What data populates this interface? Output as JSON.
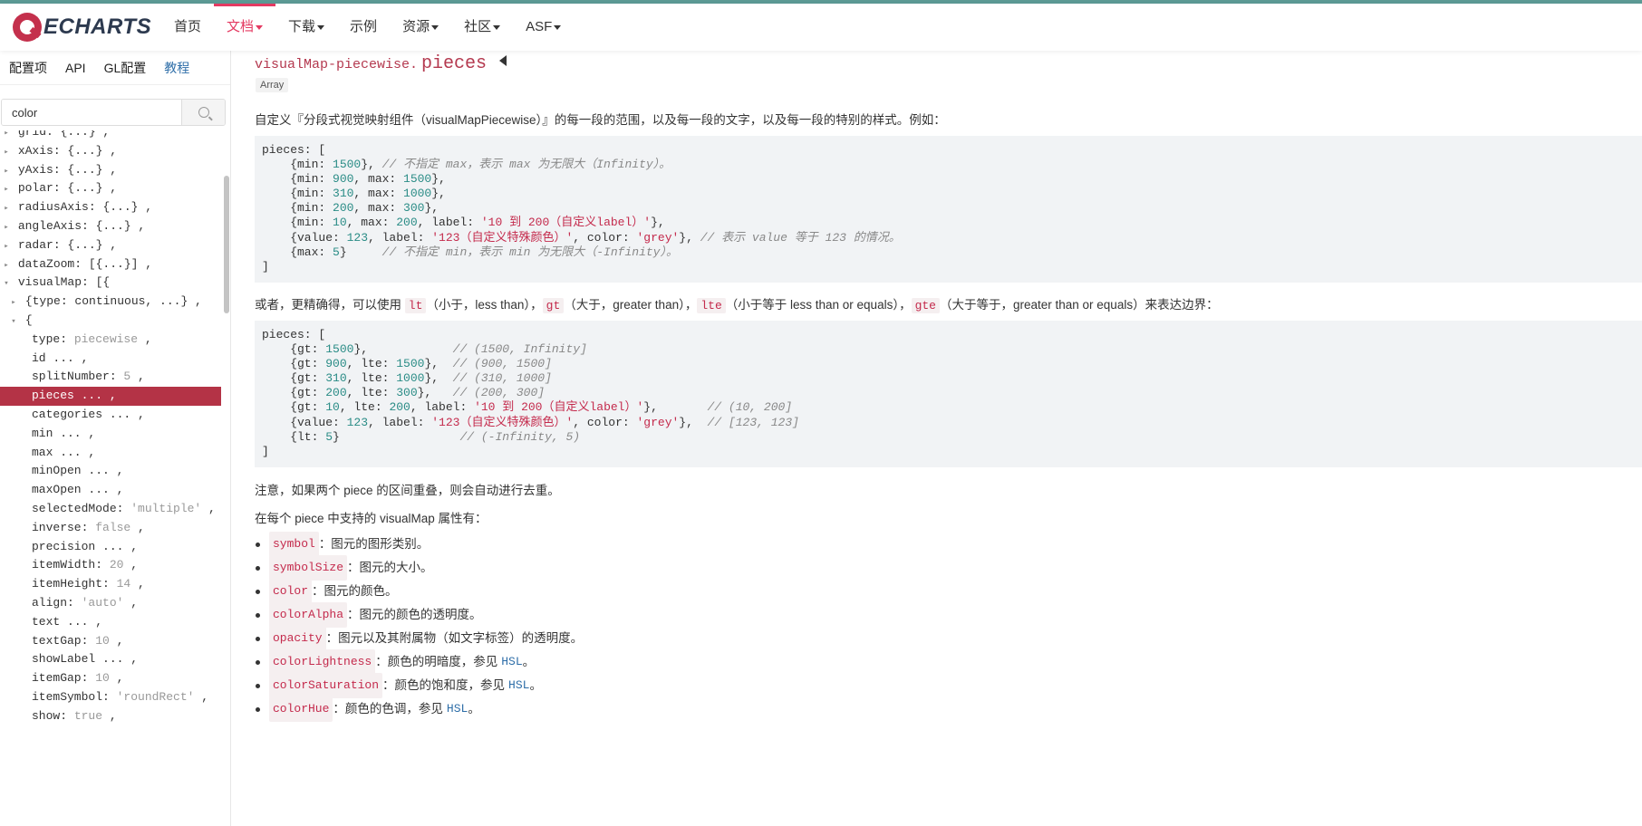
{
  "header": {
    "logo_text": "ECHARTS",
    "nav": [
      {
        "label": "首页",
        "dropdown": false,
        "active": false
      },
      {
        "label": "文档",
        "dropdown": true,
        "active": true
      },
      {
        "label": "下载",
        "dropdown": true,
        "active": false
      },
      {
        "label": "示例",
        "dropdown": false,
        "active": false
      },
      {
        "label": "资源",
        "dropdown": true,
        "active": false
      },
      {
        "label": "社区",
        "dropdown": true,
        "active": false
      },
      {
        "label": "ASF",
        "dropdown": true,
        "active": false
      }
    ]
  },
  "sidebar": {
    "tabs": [
      {
        "label": "配置项",
        "active": true
      },
      {
        "label": "API",
        "active": false
      },
      {
        "label": "GL配置",
        "active": false
      },
      {
        "label": "教程",
        "active": false,
        "link": true
      }
    ],
    "search": {
      "value": "color",
      "placeholder": ""
    },
    "tree": [
      {
        "indent": 0,
        "twisty": "▸",
        "key": "grid:",
        "val": " {...} ,",
        "dim": false
      },
      {
        "indent": 0,
        "twisty": "▸",
        "key": "xAxis:",
        "val": " {...} ,",
        "dim": false
      },
      {
        "indent": 0,
        "twisty": "▸",
        "key": "yAxis:",
        "val": " {...} ,",
        "dim": false
      },
      {
        "indent": 0,
        "twisty": "▸",
        "key": "polar:",
        "val": " {...} ,",
        "dim": false
      },
      {
        "indent": 0,
        "twisty": "▸",
        "key": "radiusAxis:",
        "val": " {...} ,",
        "dim": false
      },
      {
        "indent": 0,
        "twisty": "▸",
        "key": "angleAxis:",
        "val": " {...} ,",
        "dim": false
      },
      {
        "indent": 0,
        "twisty": "▸",
        "key": "radar:",
        "val": " {...} ,",
        "dim": false
      },
      {
        "indent": 0,
        "twisty": "▸",
        "key": "dataZoom:",
        "val": " [{...}] ,",
        "dim": false
      },
      {
        "indent": 0,
        "twisty": "▾",
        "key": "visualMap:",
        "val": " [{",
        "dim": false
      },
      {
        "indent": 1,
        "twisty": "▸",
        "key": "{type: continuous, ...} ,",
        "val": "",
        "dim": false
      },
      {
        "indent": 1,
        "twisty": "▾",
        "key": "{",
        "val": "",
        "dim": false
      },
      {
        "indent": 2,
        "twisty": "",
        "key": "type:",
        "val": " piecewise",
        "suffix": " ,",
        "dim": true
      },
      {
        "indent": 2,
        "twisty": "",
        "key": "id",
        "val": " ... ,",
        "dim": false
      },
      {
        "indent": 2,
        "twisty": "",
        "key": "splitNumber:",
        "val": " 5",
        "suffix": " ,",
        "dim": true
      },
      {
        "indent": 2,
        "twisty": "",
        "key": "pieces",
        "val": " ... ,",
        "dim": false,
        "selected": true
      },
      {
        "indent": 2,
        "twisty": "",
        "key": "categories",
        "val": " ... ,",
        "dim": false
      },
      {
        "indent": 2,
        "twisty": "",
        "key": "min",
        "val": " ... ,",
        "dim": false
      },
      {
        "indent": 2,
        "twisty": "",
        "key": "max",
        "val": " ... ,",
        "dim": false
      },
      {
        "indent": 2,
        "twisty": "",
        "key": "minOpen",
        "val": " ... ,",
        "dim": false
      },
      {
        "indent": 2,
        "twisty": "",
        "key": "maxOpen",
        "val": " ... ,",
        "dim": false
      },
      {
        "indent": 2,
        "twisty": "",
        "key": "selectedMode:",
        "val": " 'multiple'",
        "suffix": " ,",
        "dim": true
      },
      {
        "indent": 2,
        "twisty": "",
        "key": "inverse:",
        "val": " false",
        "suffix": " ,",
        "dim": true
      },
      {
        "indent": 2,
        "twisty": "",
        "key": "precision",
        "val": " ... ,",
        "dim": false
      },
      {
        "indent": 2,
        "twisty": "",
        "key": "itemWidth:",
        "val": " 20",
        "suffix": " ,",
        "dim": true
      },
      {
        "indent": 2,
        "twisty": "",
        "key": "itemHeight:",
        "val": " 14",
        "suffix": " ,",
        "dim": true
      },
      {
        "indent": 2,
        "twisty": "",
        "key": "align:",
        "val": " 'auto'",
        "suffix": " ,",
        "dim": true
      },
      {
        "indent": 2,
        "twisty": "",
        "key": "text",
        "val": " ... ,",
        "dim": false
      },
      {
        "indent": 2,
        "twisty": "",
        "key": "textGap:",
        "val": " 10",
        "suffix": " ,",
        "dim": true
      },
      {
        "indent": 2,
        "twisty": "",
        "key": "showLabel",
        "val": " ... ,",
        "dim": false
      },
      {
        "indent": 2,
        "twisty": "",
        "key": "itemGap:",
        "val": " 10",
        "suffix": " ,",
        "dim": true
      },
      {
        "indent": 2,
        "twisty": "",
        "key": "itemSymbol:",
        "val": " 'roundRect'",
        "suffix": " ,",
        "dim": true
      },
      {
        "indent": 2,
        "twisty": "",
        "key": "show:",
        "val": " true",
        "suffix": " ,",
        "dim": true
      }
    ]
  },
  "doc": {
    "title_prefix": "visualMap-piecewise.",
    "title_name": "pieces",
    "type_badge": "Array",
    "intro": "自定义『分段式视觉映射组件（visualMapPiecewise）』的每一段的范围，以及每一段的文字，以及每一段的特别的样式。例如：",
    "code1": [
      [
        [
          "t",
          "pieces: ["
        ]
      ],
      [
        [
          "t",
          "    {min: "
        ],
        [
          "n",
          "1500"
        ],
        [
          "t",
          "}, "
        ],
        [
          "c",
          "// 不指定 max，表示 max 为无限大（Infinity）。"
        ]
      ],
      [
        [
          "t",
          "    {min: "
        ],
        [
          "n",
          "900"
        ],
        [
          "t",
          ", max: "
        ],
        [
          "n",
          "1500"
        ],
        [
          "t",
          "},"
        ]
      ],
      [
        [
          "t",
          "    {min: "
        ],
        [
          "n",
          "310"
        ],
        [
          "t",
          ", max: "
        ],
        [
          "n",
          "1000"
        ],
        [
          "t",
          "},"
        ]
      ],
      [
        [
          "t",
          "    {min: "
        ],
        [
          "n",
          "200"
        ],
        [
          "t",
          ", max: "
        ],
        [
          "n",
          "300"
        ],
        [
          "t",
          "},"
        ]
      ],
      [
        [
          "t",
          "    {min: "
        ],
        [
          "n",
          "10"
        ],
        [
          "t",
          ", max: "
        ],
        [
          "n",
          "200"
        ],
        [
          "t",
          ", label: "
        ],
        [
          "s",
          "'10 到 200（自定义label）'"
        ],
        [
          "t",
          "},"
        ]
      ],
      [
        [
          "t",
          "    {value: "
        ],
        [
          "n",
          "123"
        ],
        [
          "t",
          ", label: "
        ],
        [
          "s",
          "'123（自定义特殊颜色）'"
        ],
        [
          "t",
          ", color: "
        ],
        [
          "s",
          "'grey'"
        ],
        [
          "t",
          "}, "
        ],
        [
          "c",
          "// 表示 value 等于 123 的情况。"
        ]
      ],
      [
        [
          "t",
          "    {max: "
        ],
        [
          "n",
          "5"
        ],
        [
          "t",
          "}     "
        ],
        [
          "c",
          "// 不指定 min，表示 min 为无限大（-Infinity）。"
        ]
      ],
      [
        [
          "t",
          "]"
        ]
      ]
    ],
    "middle_parts": [
      [
        "t",
        "或者，更精确得，可以使用 "
      ],
      [
        "k",
        "lt"
      ],
      [
        "t",
        "（小于，less than），"
      ],
      [
        "k",
        "gt"
      ],
      [
        "t",
        "（大于，greater than），"
      ],
      [
        "k",
        "lte"
      ],
      [
        "t",
        "（小于等于 less than or equals），"
      ],
      [
        "k",
        "gte"
      ],
      [
        "t",
        "（大于等于，greater than or equals）来表达边界："
      ]
    ],
    "code2": [
      [
        [
          "t",
          "pieces: ["
        ]
      ],
      [
        [
          "t",
          "    {gt: "
        ],
        [
          "n",
          "1500"
        ],
        [
          "t",
          "},            "
        ],
        [
          "c",
          "// (1500, Infinity]"
        ]
      ],
      [
        [
          "t",
          "    {gt: "
        ],
        [
          "n",
          "900"
        ],
        [
          "t",
          ", lte: "
        ],
        [
          "n",
          "1500"
        ],
        [
          "t",
          "},  "
        ],
        [
          "c",
          "// (900, 1500]"
        ]
      ],
      [
        [
          "t",
          "    {gt: "
        ],
        [
          "n",
          "310"
        ],
        [
          "t",
          ", lte: "
        ],
        [
          "n",
          "1000"
        ],
        [
          "t",
          "},  "
        ],
        [
          "c",
          "// (310, 1000]"
        ]
      ],
      [
        [
          "t",
          "    {gt: "
        ],
        [
          "n",
          "200"
        ],
        [
          "t",
          ", lte: "
        ],
        [
          "n",
          "300"
        ],
        [
          "t",
          "},   "
        ],
        [
          "c",
          "// (200, 300]"
        ]
      ],
      [
        [
          "t",
          "    {gt: "
        ],
        [
          "n",
          "10"
        ],
        [
          "t",
          ", lte: "
        ],
        [
          "n",
          "200"
        ],
        [
          "t",
          ", label: "
        ],
        [
          "s",
          "'10 到 200（自定义label）'"
        ],
        [
          "t",
          "},       "
        ],
        [
          "c",
          "// (10, 200]"
        ]
      ],
      [
        [
          "t",
          "    {value: "
        ],
        [
          "n",
          "123"
        ],
        [
          "t",
          ", label: "
        ],
        [
          "s",
          "'123（自定义特殊颜色）'"
        ],
        [
          "t",
          ", color: "
        ],
        [
          "s",
          "'grey'"
        ],
        [
          "t",
          "},  "
        ],
        [
          "c",
          "// [123, 123]"
        ]
      ],
      [
        [
          "t",
          "    {lt: "
        ],
        [
          "n",
          "5"
        ],
        [
          "t",
          "}                 "
        ],
        [
          "c",
          "// (-Infinity, 5)"
        ]
      ],
      [
        [
          "t",
          "]"
        ]
      ]
    ],
    "note": "注意，如果两个 piece 的区间重叠，则会自动进行去重。",
    "supported": "在每个 piece 中支持的 visualMap 属性有：",
    "bullets": [
      {
        "code": "symbol",
        "text": "：图元的图形类别。",
        "link": "",
        "after": ""
      },
      {
        "code": "symbolSize",
        "text": "：图元的大小。",
        "link": "",
        "after": ""
      },
      {
        "code": "color",
        "text": "：图元的颜色。",
        "link": "",
        "after": ""
      },
      {
        "code": "colorAlpha",
        "text": "：图元的颜色的透明度。",
        "link": "",
        "after": ""
      },
      {
        "code": "opacity",
        "text": "：图元以及其附属物（如文字标签）的透明度。",
        "link": "",
        "after": ""
      },
      {
        "code": "colorLightness",
        "text": "：颜色的明暗度，参见",
        "link": "HSL",
        "after": "。"
      },
      {
        "code": "colorSaturation",
        "text": "：颜色的饱和度，参见",
        "link": "HSL",
        "after": "。"
      },
      {
        "code": "colorHue",
        "text": "：颜色的色调，参见",
        "link": "HSL",
        "after": "。"
      }
    ]
  },
  "colors": {
    "accent": "#e43961",
    "selected": "#b43346",
    "link": "#2e6ea8"
  }
}
